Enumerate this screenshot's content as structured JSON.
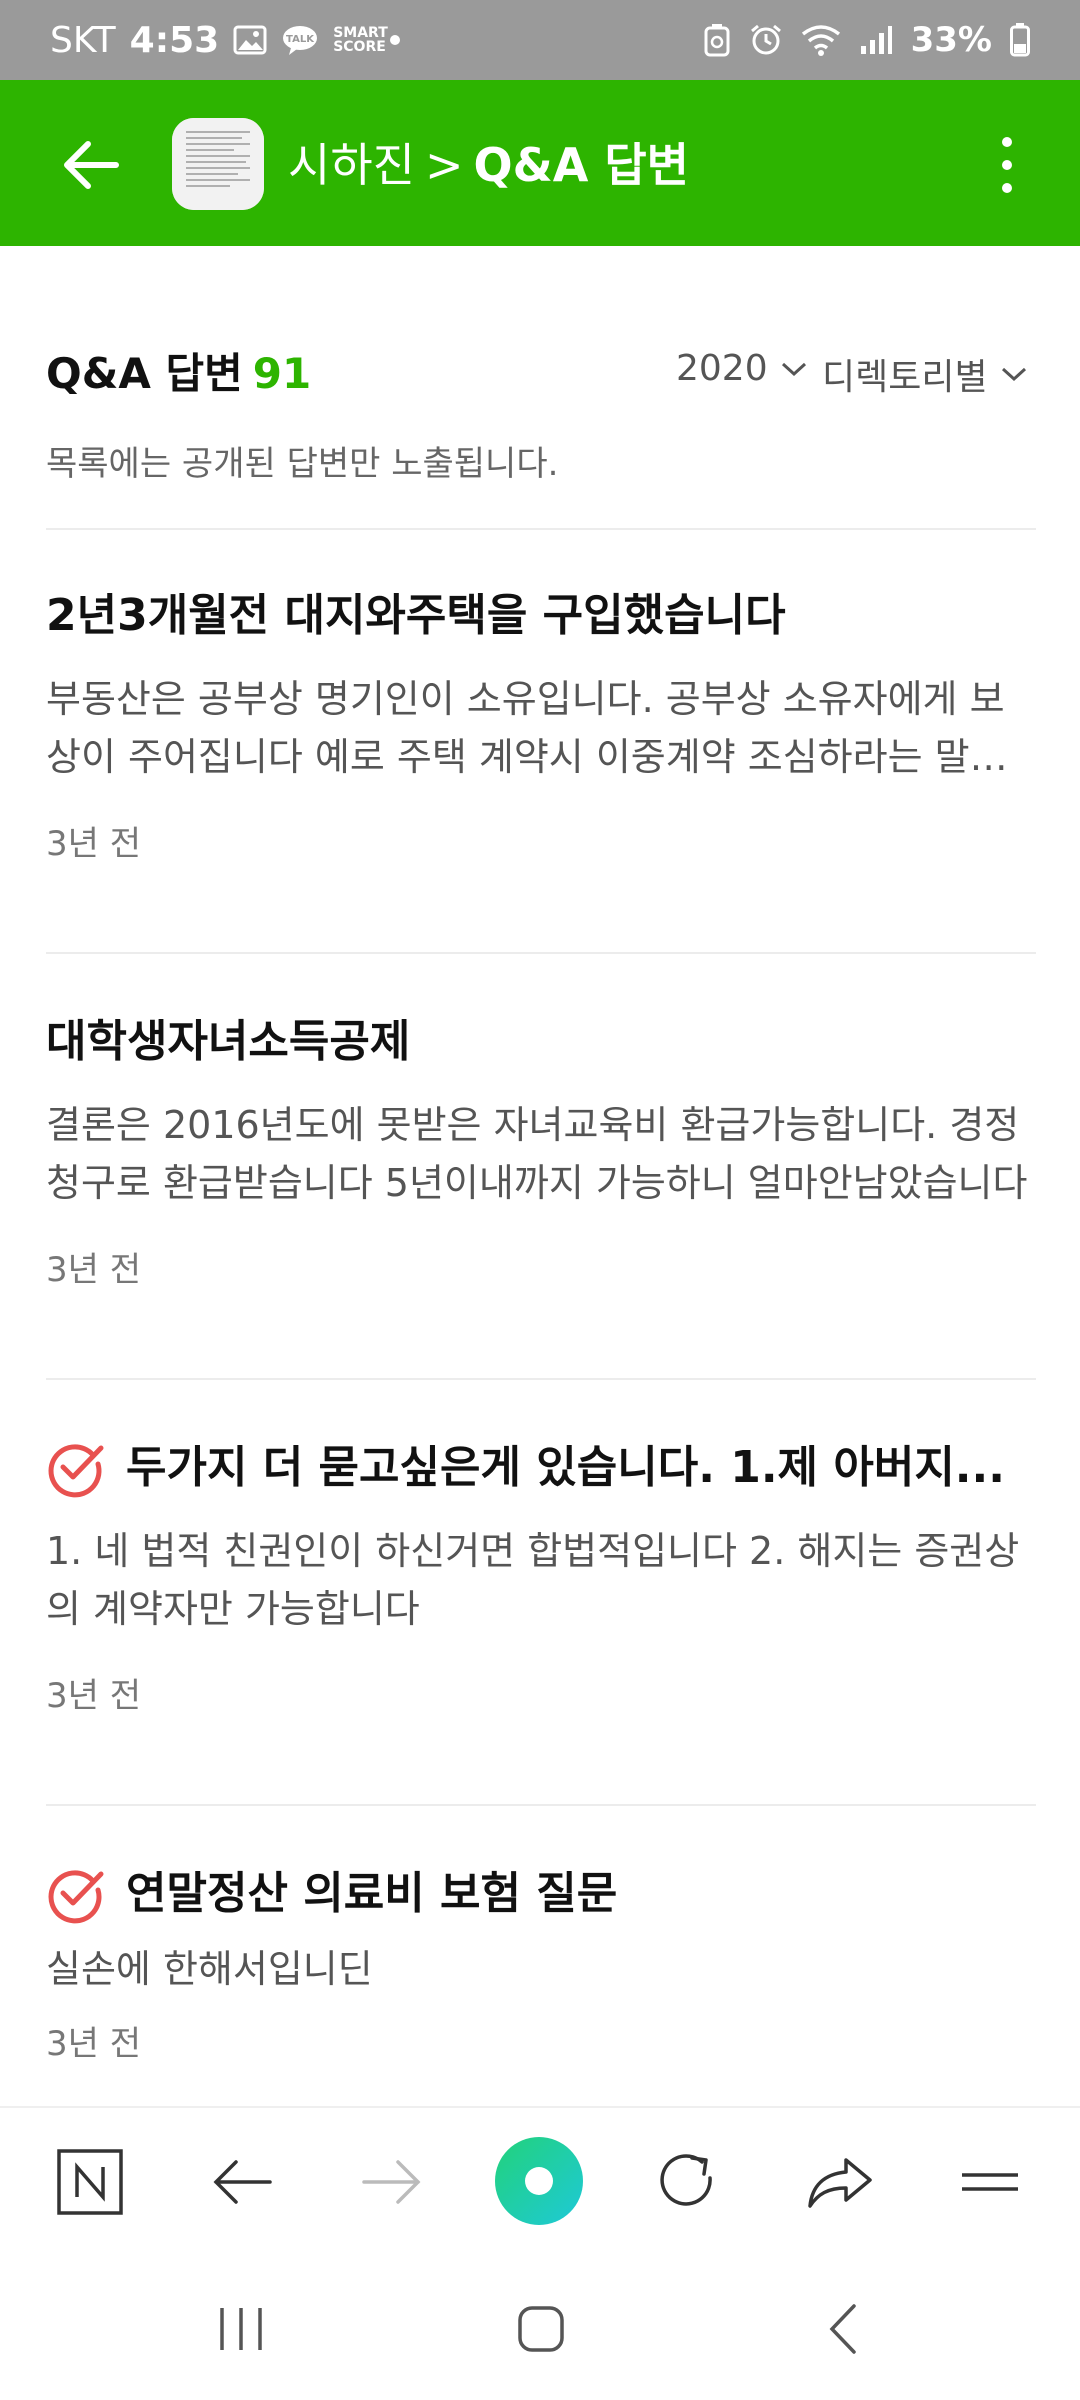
{
  "status_bar": {
    "carrier": "SKT",
    "time": "4:53",
    "smartscore": "SMART SCORE",
    "battery": "33%"
  },
  "header": {
    "blog_name": "시하진",
    "separator": ">",
    "page": "Q&A 답변"
  },
  "section": {
    "title": "Q&A 답변",
    "count": "91",
    "year_filter": "2020",
    "sort_filter": "디렉토리별",
    "notice": "목록에는 공개된 답변만 노출됩니다."
  },
  "items": [
    {
      "title": "2년3개월전 대지와주택을 구입했습니다",
      "body": "부동산은 공부상 명기인이 소유입니다. 공부상 소유자에게 보상이 주어집니다 예로 주택 계약시 이중계약 조심하라는 말이 있습니다",
      "date": "3년 전",
      "selected": false
    },
    {
      "title": "대학생자녀소득공제",
      "body": "결론은 2016년도에 못받은 자녀교육비 환급가능합니다. 경정청구로 환급받습니다 5년이내까지 가능하니 얼마안남았습니다",
      "date": "3년 전",
      "selected": false
    },
    {
      "title": "두가지 더 묻고싶은게 있습니다. 1.제 아버지...",
      "body": "1. 네 법적 친권인이 하신거면 합법적입니다 2. 해지는 증권상의 계약자만 가능합니다",
      "date": "3년 전",
      "selected": true
    },
    {
      "title": "연말정산 의료비 보험 질문",
      "body": "실손에 한해서입니딘",
      "date": "3년 전",
      "selected": true
    }
  ],
  "colors": {
    "brand_green": "#2db400",
    "check_red": "#e8514f"
  },
  "toolbar_icons": [
    "naver-n-icon",
    "back-arrow-icon",
    "forward-arrow-icon",
    "green-dot-icon",
    "refresh-icon",
    "share-icon",
    "menu-icon"
  ],
  "nav_icons": [
    "recent-apps-icon",
    "home-icon",
    "back-icon"
  ]
}
